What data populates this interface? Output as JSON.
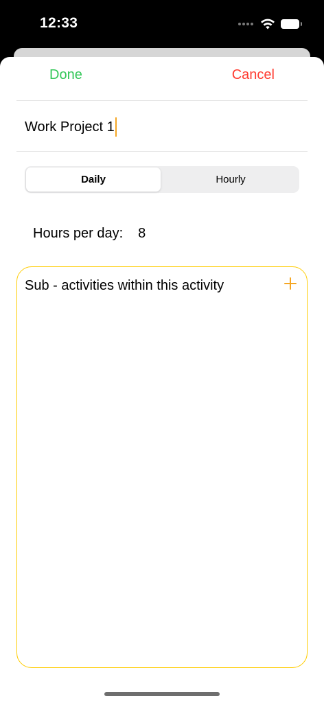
{
  "status_bar": {
    "time": "12:33"
  },
  "nav": {
    "done_label": "Done",
    "cancel_label": "Cancel"
  },
  "activity": {
    "name_value": "Work Project 1"
  },
  "frequency": {
    "options": [
      "Daily",
      "Hourly"
    ],
    "selected": "Daily"
  },
  "hours": {
    "label": "Hours per day:",
    "value": "8"
  },
  "sub_activities": {
    "title": "Sub - activities within this activity",
    "add_icon": "plus-icon"
  },
  "colors": {
    "done": "#34c759",
    "cancel": "#ff3b30",
    "accent": "#f5a623",
    "box_border": "#ffcc00"
  }
}
